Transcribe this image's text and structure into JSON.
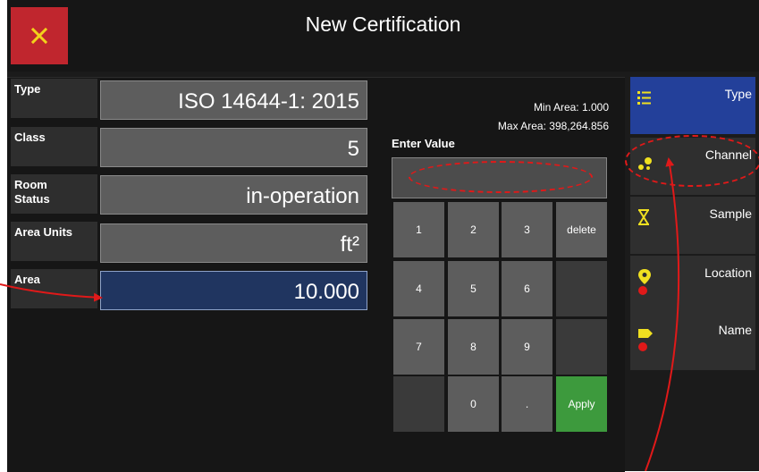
{
  "header": {
    "title": "New Certification",
    "close_icon": "close-icon"
  },
  "fields": {
    "type": {
      "label": "Type",
      "value": "ISO 14644-1: 2015"
    },
    "class": {
      "label": "Class",
      "value": "5"
    },
    "room_status": {
      "label_line1": "Room",
      "label_line2": "Status",
      "value": "in-operation"
    },
    "area_units": {
      "label": "Area Units",
      "value": "ft²"
    },
    "area": {
      "label": "Area",
      "value": "10.000"
    }
  },
  "keypad": {
    "min_area": "Min Area: 1.000",
    "max_area": "Max Area: 398,264.856",
    "enter_label": "Enter Value",
    "entry_value": "",
    "keys": {
      "k1": "1",
      "k2": "2",
      "k3": "3",
      "delete": "delete",
      "k4": "4",
      "k5": "5",
      "k6": "6",
      "k7": "7",
      "k8": "8",
      "k9": "9",
      "k0": "0",
      "dot": ".",
      "apply": "Apply"
    }
  },
  "sidebar": {
    "type": {
      "label": "Type",
      "icon": "list-icon"
    },
    "channel": {
      "label": "Channel",
      "icon": "channel-dots-icon"
    },
    "sample": {
      "label": "Sample",
      "icon": "hourglass-icon"
    },
    "location": {
      "label": "Location",
      "icon": "location-pin-icon"
    },
    "name": {
      "label": "Name",
      "icon": "tag-icon"
    }
  },
  "colors": {
    "close_button": "#c0262e",
    "selected_field": "#203560",
    "active_tab": "#23409a",
    "apply_key": "#3d9a3d",
    "icon_yellow": "#f0e020",
    "alert_red": "#e01919",
    "annotation_red": "#e01919"
  }
}
